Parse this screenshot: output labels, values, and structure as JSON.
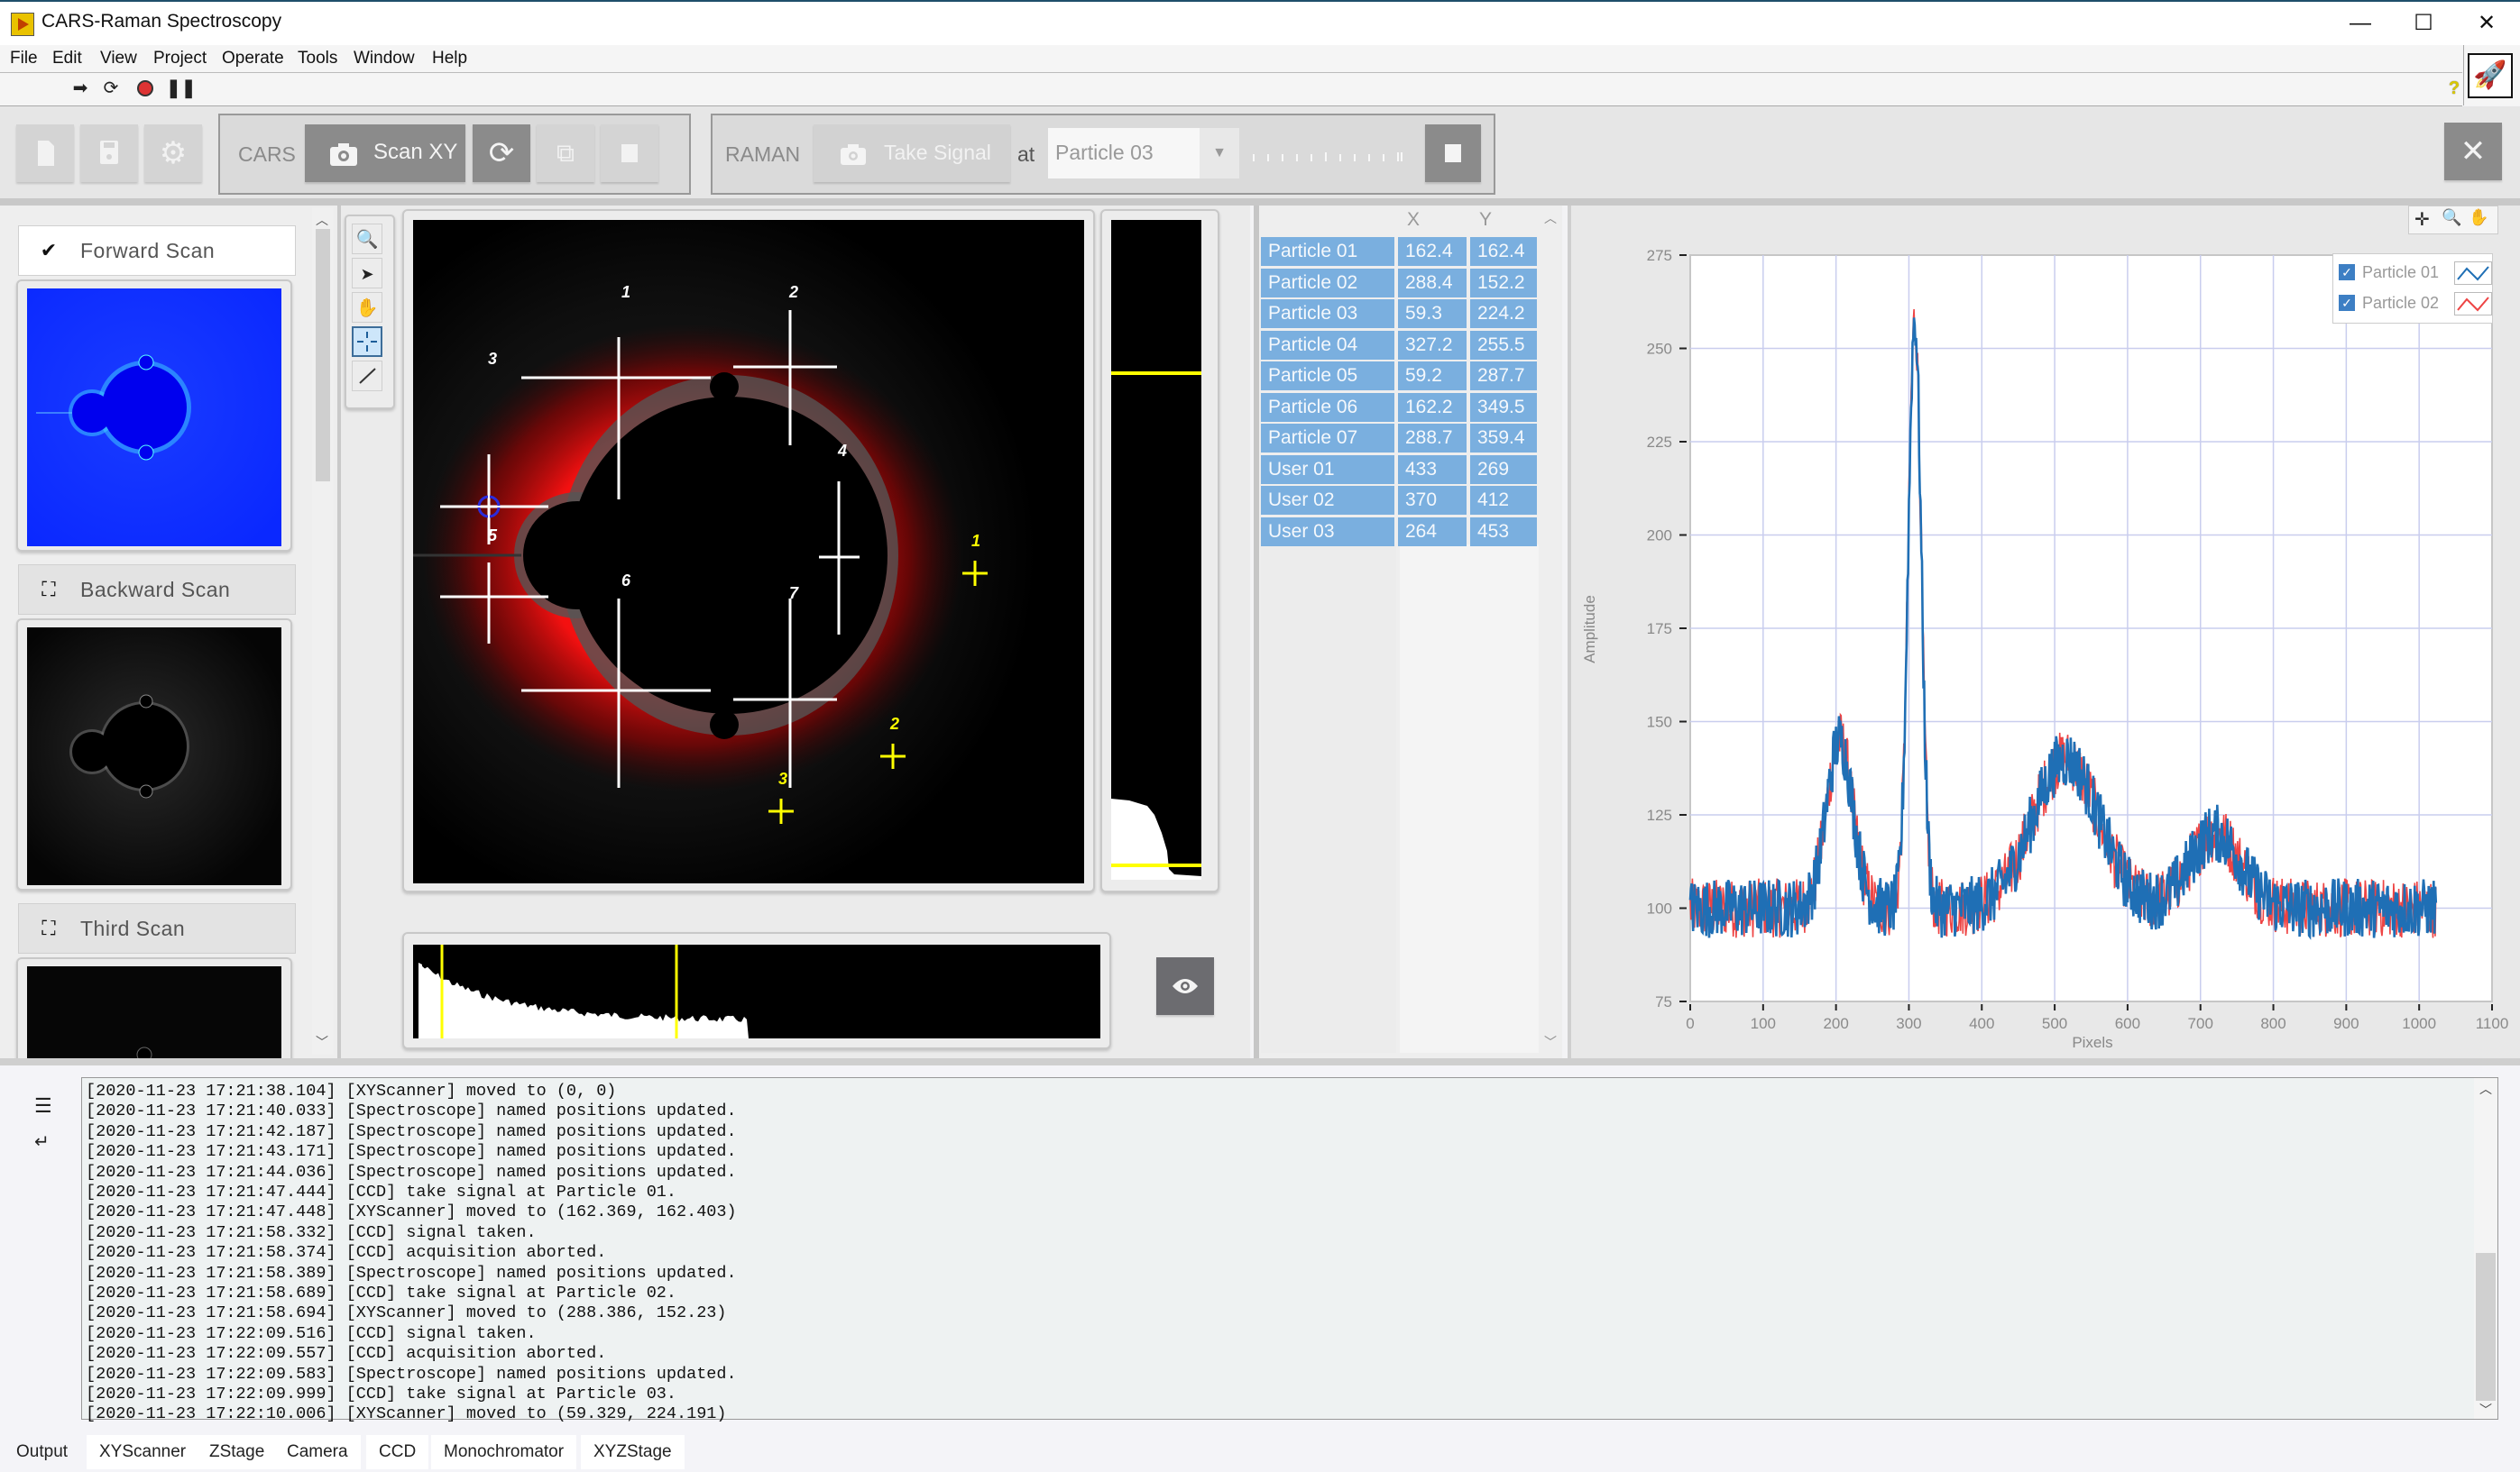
{
  "window": {
    "title": "CARS-Raman Spectroscopy",
    "controls": {
      "minimize": "—",
      "maximize": "☐",
      "close": "✕"
    }
  },
  "menu": [
    "File",
    "Edit",
    "View",
    "Project",
    "Operate",
    "Tools",
    "Window",
    "Help"
  ],
  "runbar": {
    "icons": [
      "run-arrow-icon",
      "run-continuously-icon",
      "abort-icon",
      "pause-icon"
    ],
    "help": "?"
  },
  "toolbar": {
    "new_icon": "new-file-icon",
    "save_icon": "save-icon",
    "settings_icon": "gear-icon",
    "cars": {
      "label": "CARS",
      "scan_button": "Scan XY",
      "icons": [
        "refresh-icon",
        "add-copy-icon",
        "stop-icon"
      ]
    },
    "raman": {
      "label": "RAMAN",
      "take_signal": "Take Signal",
      "at": "at",
      "selected_particle": "Particle 03",
      "stop_icon": "stop-icon"
    },
    "close_icon": "✕"
  },
  "scans": [
    {
      "label": "Forward Scan",
      "state": "selected",
      "icon": "✔"
    },
    {
      "label": "Backward Scan",
      "state": "normal",
      "icon": "scan-icon"
    },
    {
      "label": "Third Scan",
      "state": "normal",
      "icon": "scan-icon"
    }
  ],
  "image_tools": [
    "zoom",
    "pointer",
    "pan",
    "crosshair",
    "line"
  ],
  "active_image_tool": "crosshair",
  "markers": {
    "white": [
      "1",
      "2",
      "3",
      "4",
      "5",
      "6",
      "7"
    ],
    "yellow": [
      "1",
      "2",
      "3"
    ]
  },
  "table": {
    "headers": [
      "",
      "X",
      "Y"
    ],
    "rows": [
      [
        "Particle 01",
        "162.4",
        "162.4"
      ],
      [
        "Particle 02",
        "288.4",
        "152.2"
      ],
      [
        "Particle 03",
        "59.3",
        "224.2"
      ],
      [
        "Particle 04",
        "327.2",
        "255.5"
      ],
      [
        "Particle 05",
        "59.2",
        "287.7"
      ],
      [
        "Particle 06",
        "162.2",
        "349.5"
      ],
      [
        "Particle 07",
        "288.7",
        "359.4"
      ],
      [
        "User 01",
        "433",
        "269"
      ],
      [
        "User 02",
        "370",
        "412"
      ],
      [
        "User 03",
        "264",
        "453"
      ]
    ]
  },
  "chart_data": {
    "type": "line",
    "title": "",
    "xlabel": "Pixels",
    "ylabel": "Amplitude",
    "xlim": [
      0,
      1100
    ],
    "ylim": [
      75,
      275
    ],
    "xticks": [
      0,
      100,
      200,
      300,
      400,
      500,
      600,
      700,
      800,
      900,
      1000,
      1100
    ],
    "yticks": [
      75,
      100,
      125,
      150,
      175,
      200,
      225,
      250,
      275
    ],
    "grid": true,
    "legend_position": "top-right",
    "baseline": 100,
    "noise": 5,
    "x_range_points": [
      0,
      1023
    ],
    "peaks": [
      {
        "center": 205,
        "height": 45,
        "width": 18
      },
      {
        "center": 308,
        "height": 158,
        "width": 9
      },
      {
        "center": 515,
        "height": 40,
        "width": 45
      },
      {
        "center": 720,
        "height": 20,
        "width": 35
      }
    ],
    "series": [
      {
        "name": "Particle 01",
        "color": "#1f6fb5",
        "checked": true
      },
      {
        "name": "Particle 02",
        "color": "#ee4444",
        "checked": true
      }
    ]
  },
  "log": [
    "[2020-11-23 17:21:38.104] [XYScanner] moved to (0, 0)",
    "[2020-11-23 17:21:40.033] [Spectroscope] named positions updated.",
    "[2020-11-23 17:21:42.187] [Spectroscope] named positions updated.",
    "[2020-11-23 17:21:43.171] [Spectroscope] named positions updated.",
    "[2020-11-23 17:21:44.036] [Spectroscope] named positions updated.",
    "[2020-11-23 17:21:47.444] [CCD] take signal at Particle 01.",
    "[2020-11-23 17:21:47.448] [XYScanner] moved to (162.369, 162.403)",
    "[2020-11-23 17:21:58.332] [CCD] signal taken.",
    "[2020-11-23 17:21:58.374] [CCD] acquisition aborted.",
    "[2020-11-23 17:21:58.389] [Spectroscope] named positions updated.",
    "[2020-11-23 17:21:58.689] [CCD] take signal at Particle 02.",
    "[2020-11-23 17:21:58.694] [XYScanner] moved to (288.386, 152.23)",
    "[2020-11-23 17:22:09.516] [CCD] signal taken.",
    "[2020-11-23 17:22:09.557] [CCD] acquisition aborted.",
    "[2020-11-23 17:22:09.583] [Spectroscope] named positions updated.",
    "[2020-11-23 17:22:09.999] [CCD] take signal at Particle 03.",
    "[2020-11-23 17:22:10.006] [XYScanner] moved to (59.329, 224.191)"
  ],
  "output_tabs": {
    "label": "Output",
    "tabs": [
      "XYScanner",
      "ZStage",
      "Camera",
      "CCD",
      "Monochromator",
      "XYZStage"
    ]
  },
  "colors": {
    "selection": "#7aafdf",
    "marker_white": "#ffffff",
    "marker_yellow": "#ffff00",
    "scan_blue": "#0a28ff"
  }
}
